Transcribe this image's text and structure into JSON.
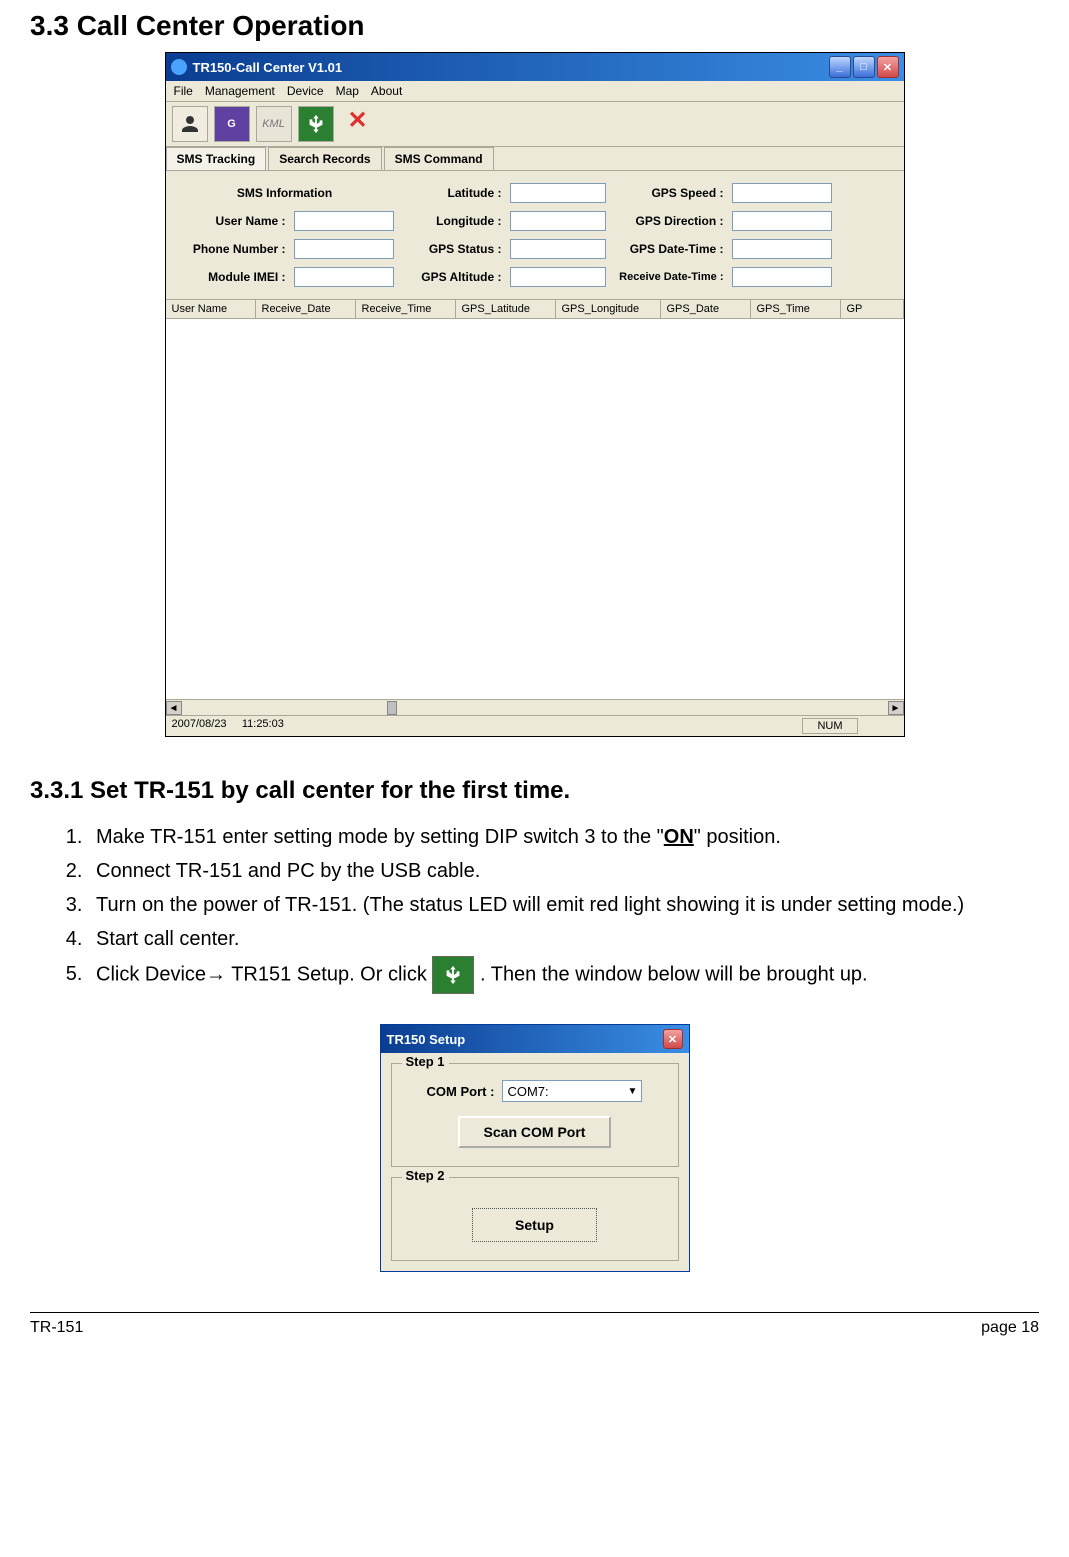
{
  "section_title": "3.3 Call Center Operation",
  "app": {
    "title": "TR150-Call Center V1.01",
    "menu": [
      "File",
      "Management",
      "Device",
      "Map",
      "About"
    ],
    "toolbar": {
      "g": "G",
      "kml": "KML",
      "x": "✕"
    },
    "tabs": [
      "SMS Tracking",
      "Search Records",
      "SMS Command"
    ],
    "form": {
      "sms_info_header": "SMS Information",
      "user_name": "User Name :",
      "phone_number": "Phone Number :",
      "module_imei": "Module IMEI :",
      "latitude": "Latitude :",
      "longitude": "Longitude :",
      "gps_status": "GPS Status :",
      "gps_altitude": "GPS Altitude :",
      "gps_speed": "GPS Speed :",
      "gps_direction": "GPS Direction :",
      "gps_datetime": "GPS Date-Time :",
      "receive_datetime": "Receive Date-Time :"
    },
    "columns": [
      "User Name",
      "Receive_Date",
      "Receive_Time",
      "GPS_Latitude",
      "GPS_Longitude",
      "GPS_Date",
      "GPS_Time",
      "GP"
    ],
    "status": {
      "date": "2007/08/23",
      "time": "11:25:03",
      "num": "NUM"
    }
  },
  "subsection_title": "3.3.1 Set TR-151 by call center for the first time.",
  "steps": {
    "s1a": "Make TR-151 enter setting mode by setting DIP switch 3 to the \"",
    "s1b": "ON",
    "s1c": "\" position.",
    "s2": "Connect TR-151 and PC by the USB cable.",
    "s3": "Turn on the power of TR-151. (The status LED will emit red light showing it is under setting mode.)",
    "s4": "Start call center.",
    "s5a": "Click Device→ TR151 Setup. Or click ",
    "s5b": ". Then the window below will be brought up."
  },
  "dialog": {
    "title": "TR150 Setup",
    "step1": "Step 1",
    "com_label": "COM Port :",
    "com_value": "COM7:",
    "scan_btn": "Scan COM Port",
    "step2": "Step 2",
    "setup_btn": "Setup"
  },
  "footer": {
    "left": "TR-151",
    "right": "page 18"
  }
}
